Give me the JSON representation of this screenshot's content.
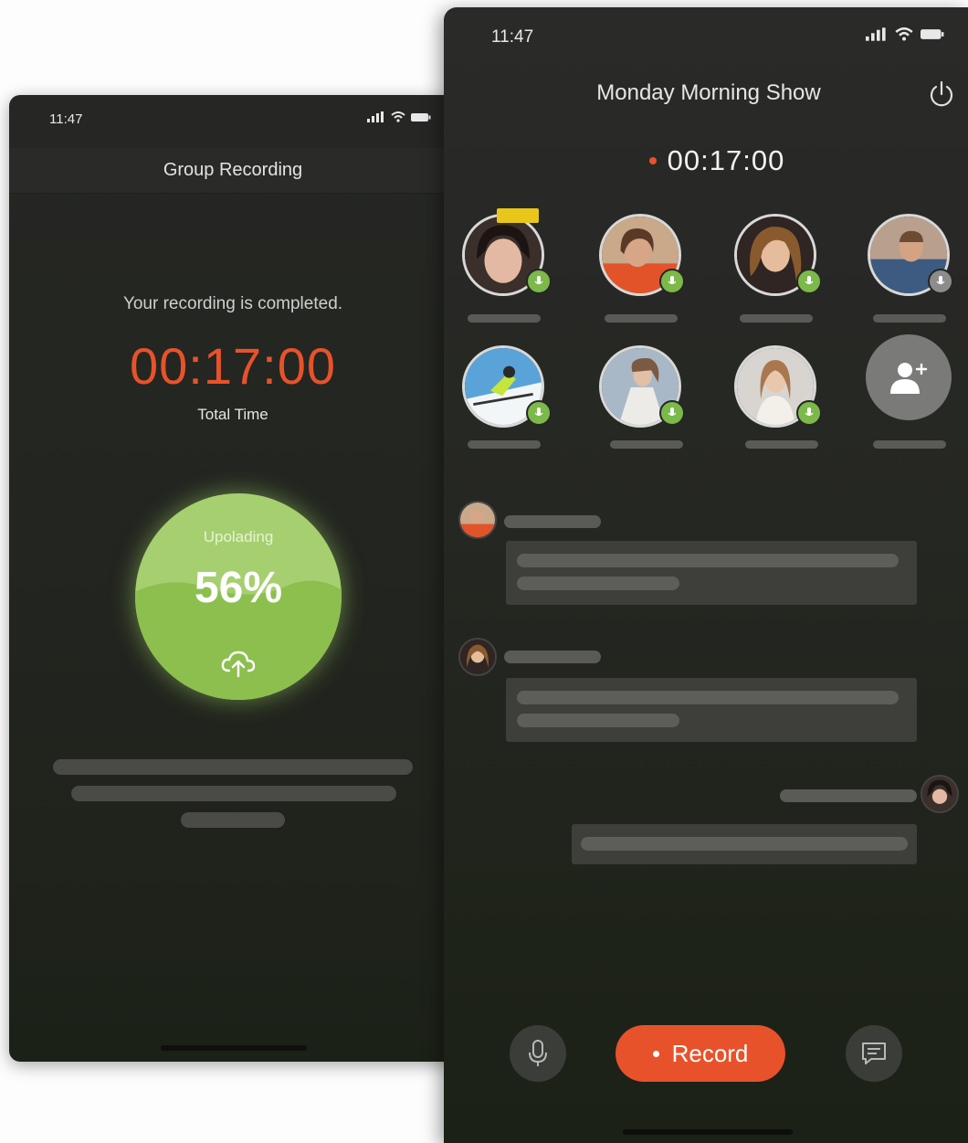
{
  "left_phone": {
    "status_time": "11:47",
    "header_title": "Group Recording",
    "completed_message": "Your recording is completed.",
    "timer": "00:17:00",
    "timer_caption": "Total Time",
    "upload": {
      "label": "Upolading",
      "percent_text": "56%",
      "progress": 0.56
    }
  },
  "right_phone": {
    "status_time": "11:47",
    "header_title": "Monday Morning Show",
    "timer": "00:17:00",
    "participants": [
      {
        "host": true,
        "mic": "active"
      },
      {
        "host": false,
        "mic": "active"
      },
      {
        "host": false,
        "mic": "active"
      },
      {
        "host": false,
        "mic": "muted"
      },
      {
        "host": false,
        "mic": "active"
      },
      {
        "host": false,
        "mic": "active"
      },
      {
        "host": false,
        "mic": "active"
      }
    ],
    "record_button": "Record"
  },
  "colors": {
    "accent_orange": "#e8522a",
    "upload_green": "#a6cf70",
    "mic_green": "#7cb84a",
    "host_yellow": "#e8c61a"
  }
}
